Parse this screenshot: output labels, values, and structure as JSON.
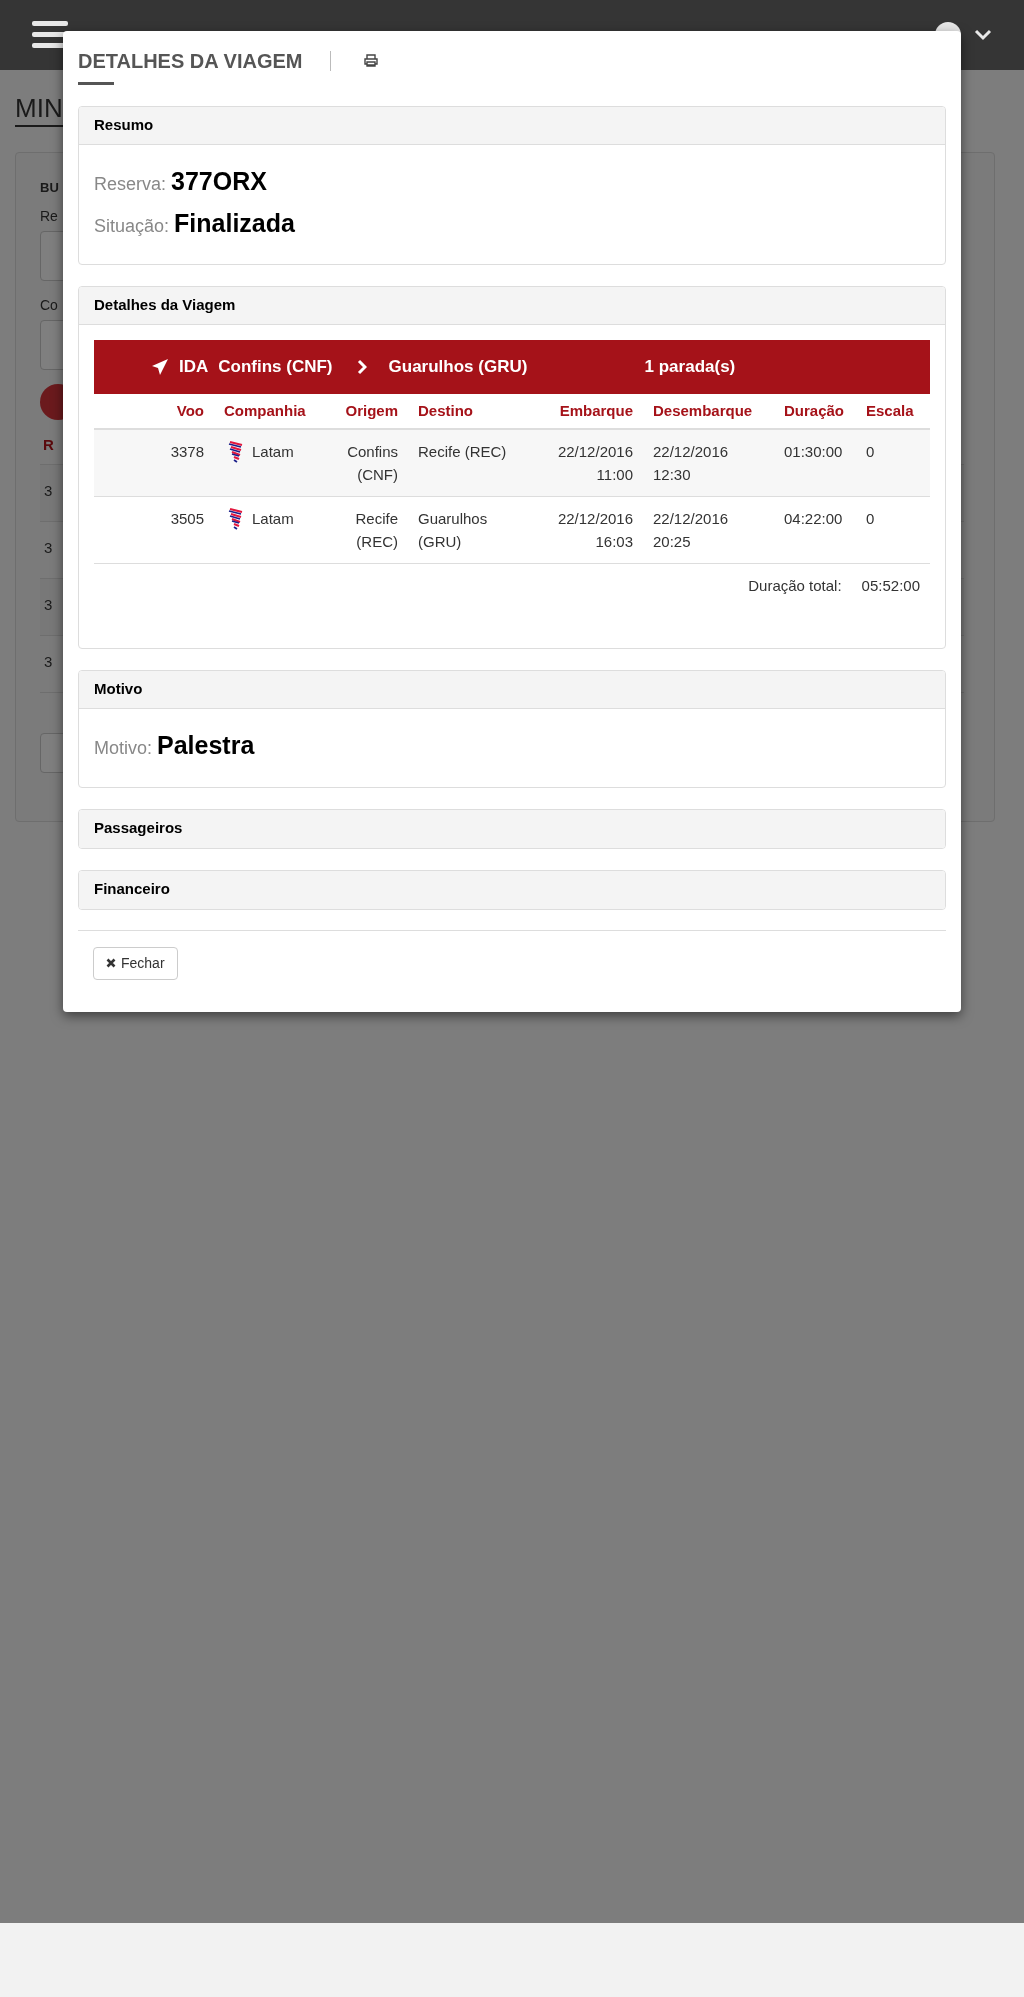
{
  "background_page": {
    "title": "MIN",
    "section_label": "BU",
    "field_labels": [
      "Re",
      "Co"
    ],
    "table_header": "R",
    "row_cells": [
      "3",
      "3",
      "3",
      "3"
    ]
  },
  "modal": {
    "title": "DETALHES DA VIAGEM",
    "panels": [
      {
        "kind": "summary",
        "title": "Resumo",
        "fields": [
          {
            "label": "Reserva:",
            "value": "377ORX"
          },
          {
            "label": "Situação:",
            "value": "Finalizada"
          }
        ]
      },
      {
        "kind": "itinerary",
        "title": "Detalhes da Viagem",
        "leg": {
          "direction": "IDA",
          "origin": "Confins (CNF)",
          "destination": "Guarulhos (GRU)",
          "stops": "1 parada(s)"
        },
        "columns": [
          "Voo",
          "Companhia",
          "Origem",
          "Destino",
          "Embarque",
          "Desembarque",
          "Duração",
          "Escala"
        ],
        "rows": [
          [
            "3378",
            "Latam",
            "Confins (CNF)",
            "Recife (REC)",
            "22/12/2016 11:00",
            "22/12/2016 12:30",
            "01:30:00",
            "0"
          ],
          [
            "3505",
            "Latam",
            "Recife (REC)",
            "Guarulhos (GRU)",
            "22/12/2016 16:03",
            "22/12/2016 20:25",
            "04:22:00",
            "0"
          ]
        ],
        "total": {
          "label": "Duração total:",
          "value": "05:52:00"
        }
      },
      {
        "kind": "summary",
        "title": "Motivo",
        "fields": [
          {
            "label": "Motivo:",
            "value": "Palestra"
          }
        ]
      },
      {
        "kind": "collapsed",
        "title": "Passageiros"
      },
      {
        "kind": "collapsed",
        "title": "Financeiro"
      }
    ],
    "close_button": "Fechar"
  }
}
